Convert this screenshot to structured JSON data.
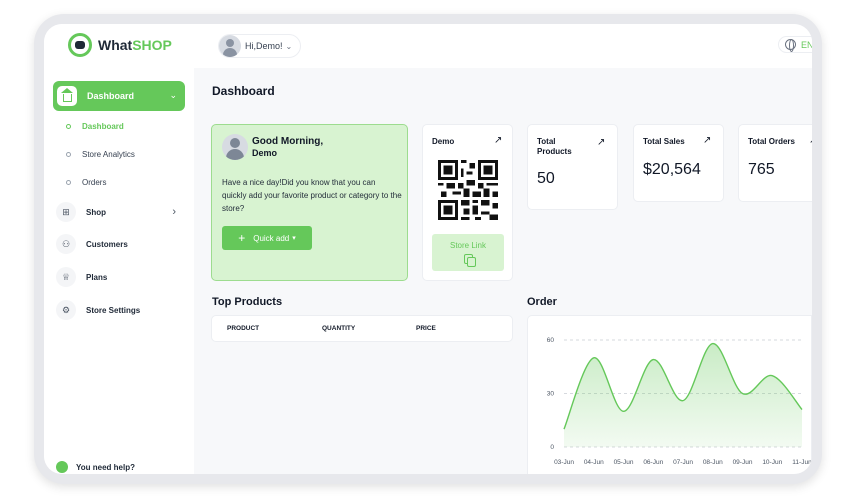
{
  "app": {
    "logo_prefix": "What",
    "logo_suffix": "SHOP"
  },
  "header": {
    "greeting": "Hi,Demo!",
    "language": "EN"
  },
  "sidebar": {
    "dashboard": "Dashboard",
    "sub_items": [
      "Dashboard",
      "Store Analytics",
      "Orders"
    ],
    "shop": "Shop",
    "customers": "Customers",
    "plans": "Plans",
    "store_settings": "Store Settings",
    "help": "You need help?"
  },
  "page": {
    "title": "Dashboard"
  },
  "greeting_card": {
    "hello": "Good Morning,",
    "name": "Demo",
    "message": "Have a nice day!Did you know that you can quickly add your favorite product or category to the store?",
    "quick_add": "Quick add"
  },
  "demo_card": {
    "title": "Demo",
    "store_link": "Store Link"
  },
  "stats": [
    {
      "title": "Total Products",
      "value": "50"
    },
    {
      "title": "Total Sales",
      "value": "$20,564"
    },
    {
      "title": "Total Orders",
      "value": "765"
    }
  ],
  "top_products": {
    "title": "Top Products",
    "columns": [
      "PRODUCT",
      "QUANTITY",
      "PRICE"
    ]
  },
  "order_chart": {
    "title": "Order"
  },
  "chart_data": {
    "type": "area",
    "title": "Order",
    "x": [
      "03-Jun",
      "04-Jun",
      "05-Jun",
      "06-Jun",
      "07-Jun",
      "08-Jun",
      "09-Jun",
      "10-Jun",
      "11-Jun"
    ],
    "y": [
      10,
      50,
      20,
      49,
      26,
      58,
      30,
      40,
      21
    ],
    "yticks": [
      0,
      30,
      60
    ],
    "ylim": [
      0,
      60
    ],
    "grid": true,
    "colors": {
      "line": "#65c85a",
      "fill": "#d8f3d1"
    }
  }
}
